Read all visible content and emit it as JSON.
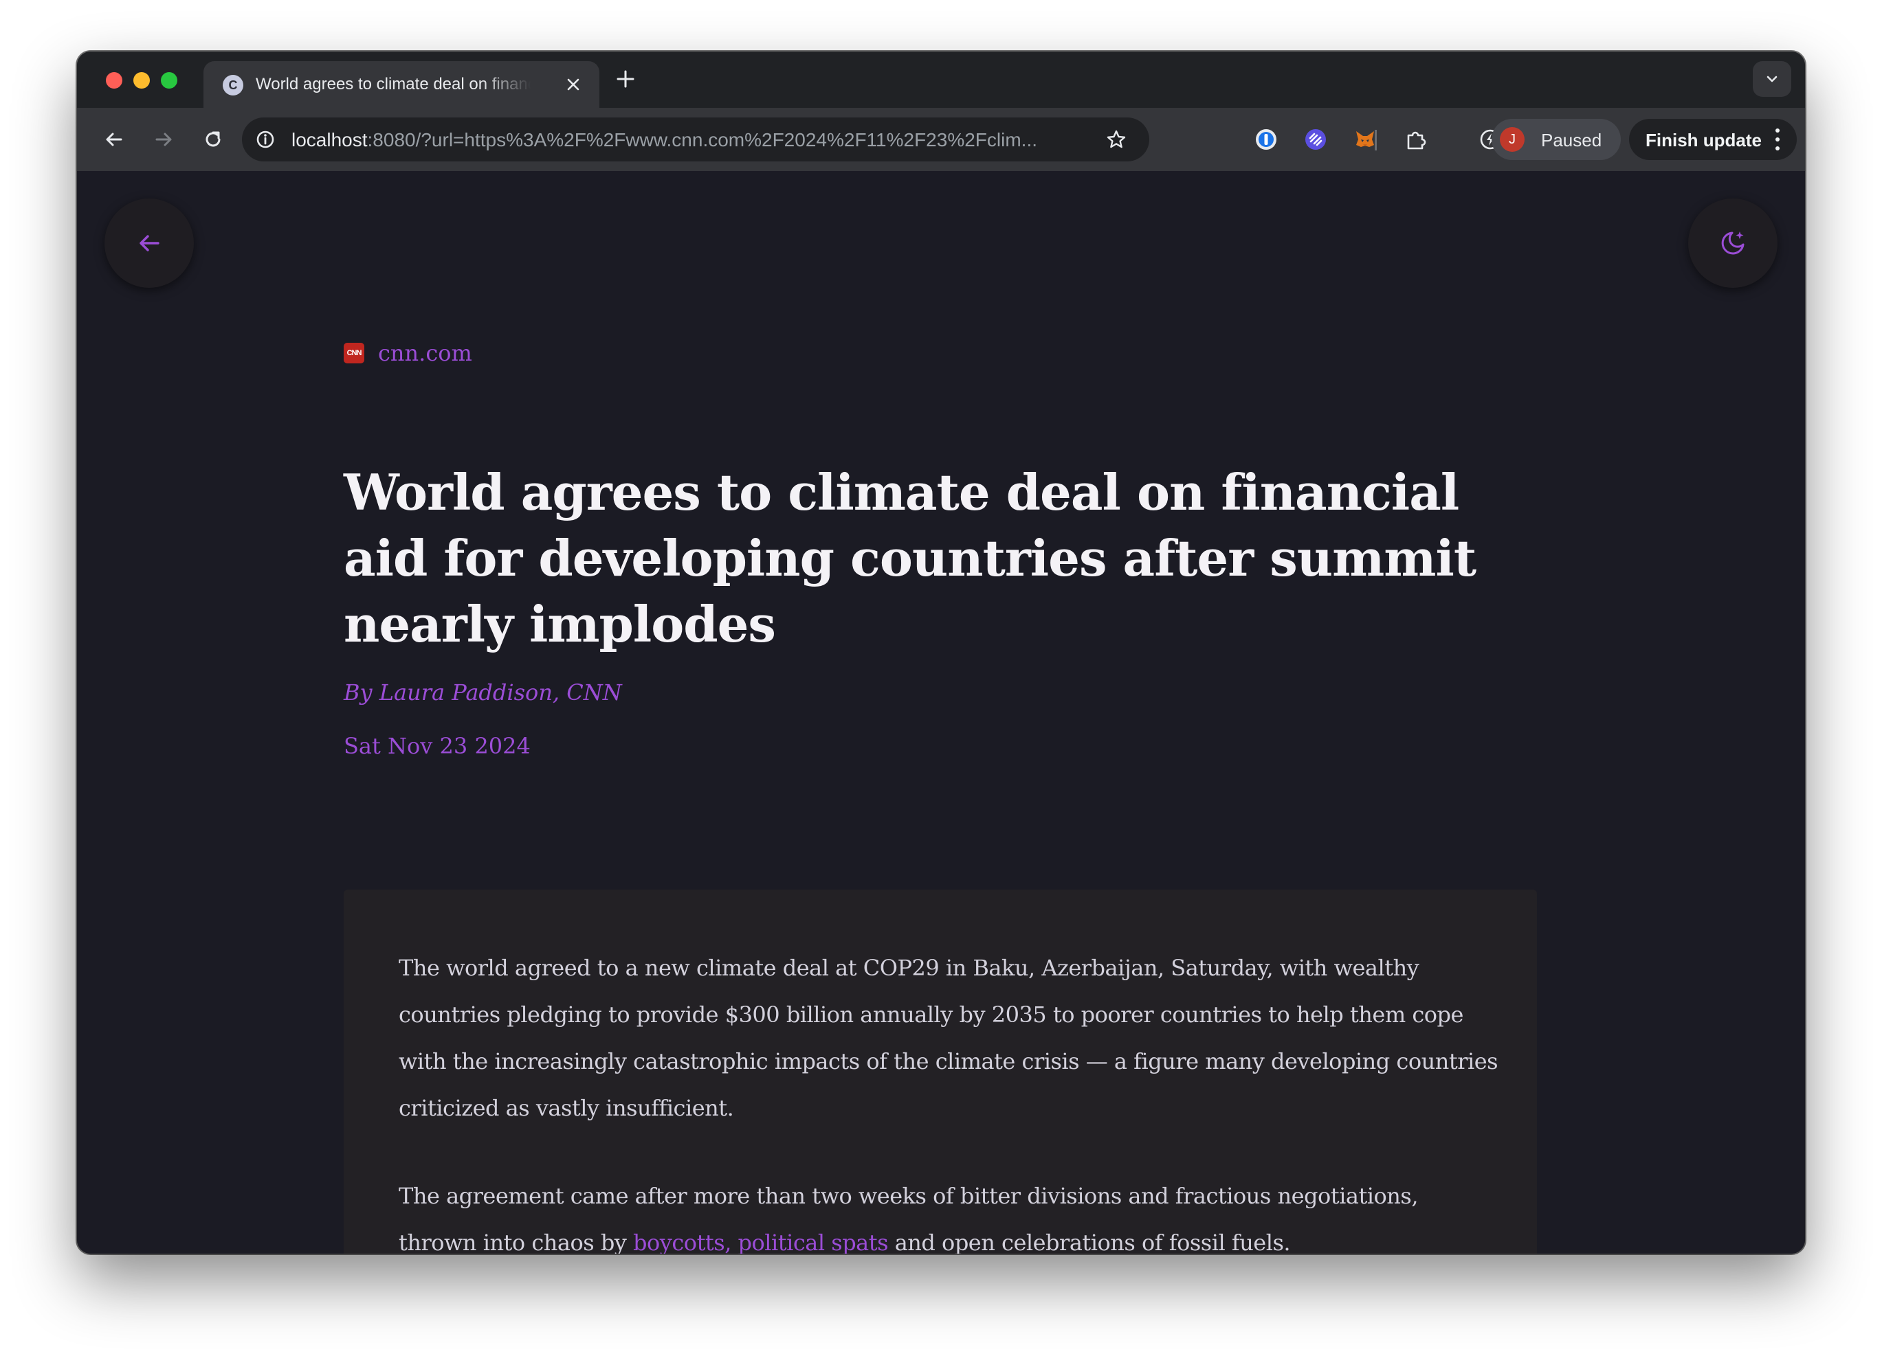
{
  "browser": {
    "tab": {
      "favicon_letter": "C",
      "title": "World agrees to climate deal on financial aid for developing countries after summit nearly implodes"
    },
    "toolbar": {
      "url_host": "localhost",
      "url_rest": ":8080/?url=https%3A%2F%2Fwww.cnn.com%2F2024%2F11%2F23%2Fclim...",
      "profile": {
        "initial": "J",
        "label": "Paused"
      },
      "finish_update_label": "Finish update"
    },
    "extensions": [
      "password-manager-icon",
      "link-extension-icon",
      "metamask-fox-icon",
      "puzzle-piece-icon",
      "lightning-extension-icon"
    ]
  },
  "article": {
    "source_logo_text": "CNN",
    "source": "cnn.com",
    "title": "World agrees to climate deal on financial aid for developing countries after summit nearly implodes",
    "byline": "By Laura Paddison, CNN",
    "date": "Sat Nov 23 2024",
    "paragraph1": "The world agreed to a new climate deal at COP29 in Baku, Azerbaijan, Saturday, with wealthy countries pledging to provide $300 billion annually by 2035 to poorer countries to help them cope with the increasingly catastrophic impacts of the climate crisis — a figure many developing countries criticized as vastly insufficient.",
    "paragraph2_before": "The agreement came after more than two weeks of bitter divisions and fractious negotiations, thrown into chaos by ",
    "paragraph2_link": "boycotts, political spats",
    "paragraph2_after": " and open celebrations of fossil fuels."
  },
  "colors": {
    "accent": "#9b4dd6",
    "page_background": "#1b1b24",
    "card_background": "#232125",
    "headline": "#f4f2f6",
    "body_text": "#d3d1dc"
  }
}
